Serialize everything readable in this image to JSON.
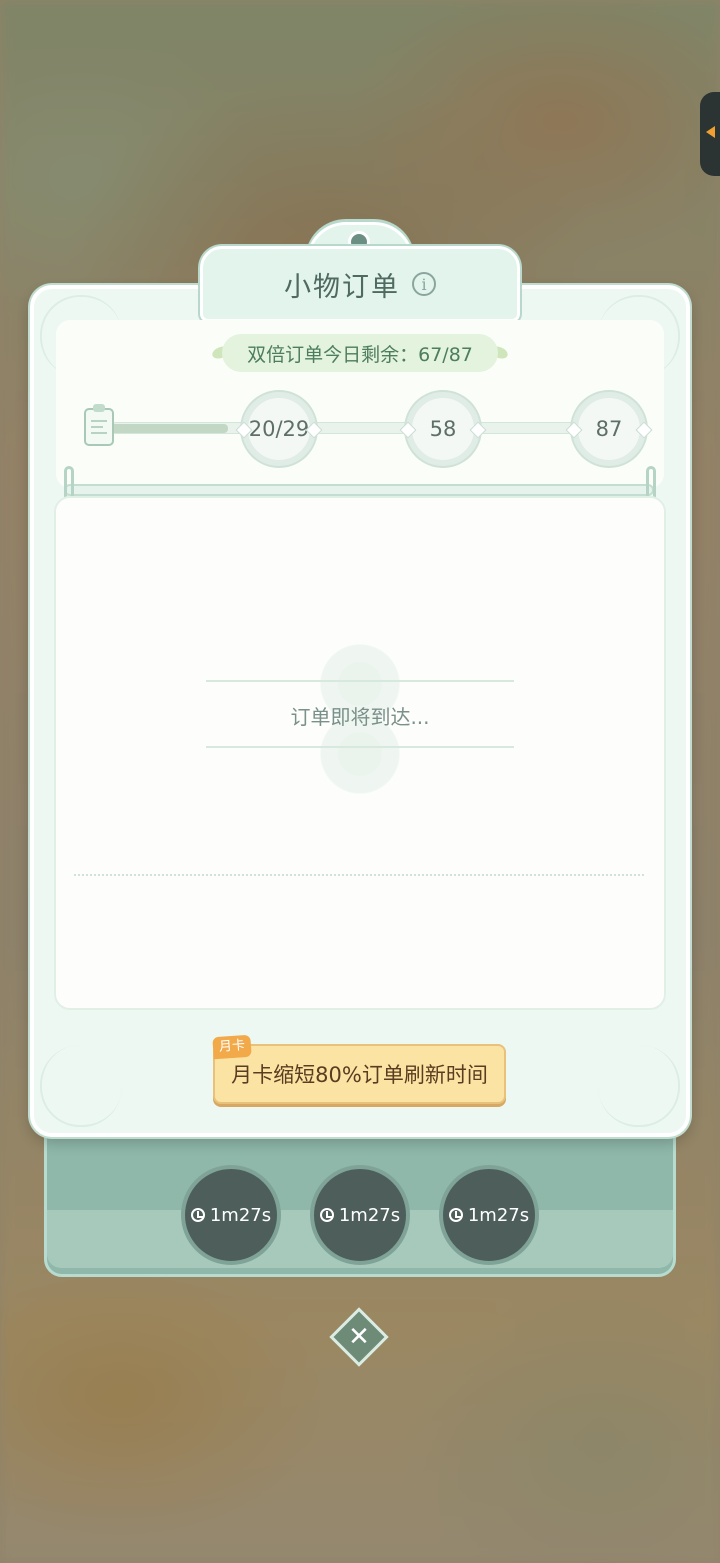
{
  "window": {
    "title": "小物订单"
  },
  "double_orders": {
    "label": "双倍订单今日剩余：67/87"
  },
  "progress": {
    "current": 20,
    "fill_fraction": 0.22,
    "milestones": [
      {
        "label": "20/29"
      },
      {
        "label": "58"
      },
      {
        "label": "87"
      }
    ]
  },
  "status": {
    "waiting": "订单即将到达..."
  },
  "monthly_card": {
    "tag": "月卡",
    "label": "月卡缩短80%订单刷新时间"
  },
  "timers": [
    {
      "label": "1m27s"
    },
    {
      "label": "1m27s"
    },
    {
      "label": "1m27s"
    }
  ],
  "icons": {
    "info": "info-icon",
    "close": "close-icon",
    "clock": "clock-icon",
    "clipboard": "clipboard-icon"
  },
  "colors": {
    "accent": "#4d7d5d",
    "panel": "#eef8f2",
    "button": "#fbe3a4"
  }
}
